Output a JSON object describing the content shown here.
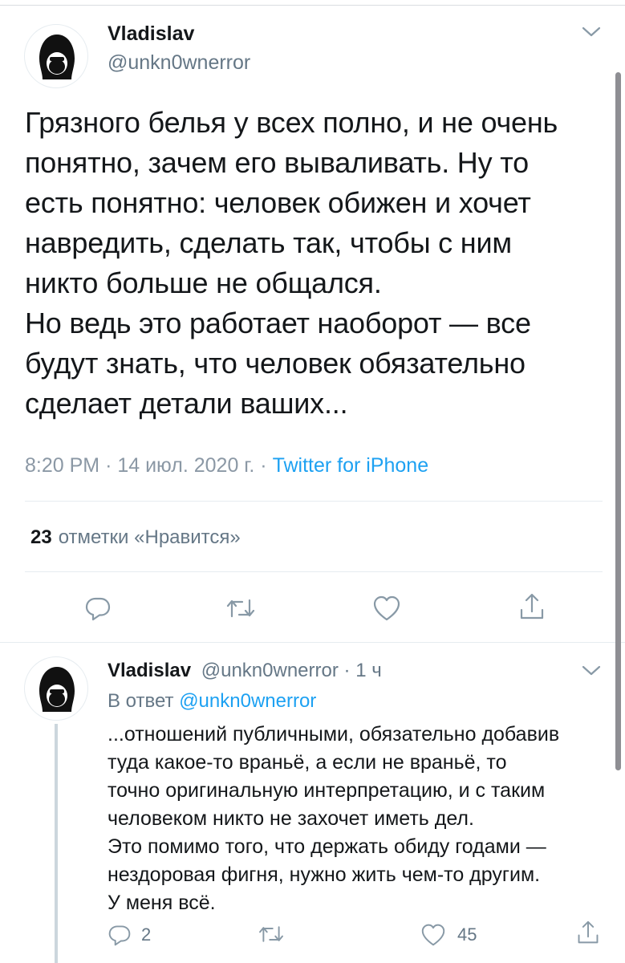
{
  "main_tweet": {
    "author_name": "Vladislav",
    "author_handle": "@unkn0wnerror",
    "text": "Грязного белья у всех полно, и не очень\nпонятно, зачем его вываливать. Ну то\nесть понятно: человек обижен и хочет\nнавредить, сделать так, чтобы с ним\nникто больше не общался.\nНо ведь это работает наоборот — все\nбудут знать, что человек обязательно\nсделает детали ваших...",
    "time": "8:20 PM",
    "date": "14 июл. 2020 г.",
    "source": "Twitter for iPhone",
    "separator": "·",
    "likes_count": "23",
    "likes_label": "отметки «Нравится»"
  },
  "reply_tweet": {
    "author_name": "Vladislav",
    "author_handle": "@unkn0wnerror",
    "time_ago": "1 ч",
    "separator": "·",
    "reply_prefix": "В ответ",
    "reply_to": "@unkn0wnerror",
    "text": "...отношений публичными, обязательно добавив\nтуда какое-то враньё, а если не враньё, то\nточно оригинальную интерпретацию, и с таким\nчеловеком никто не захочет иметь дел.\nЭто помимо того, что держать обиду годами —\nнездоровая фигня, нужно жить чем-то другим.\nУ меня всё.",
    "reply_count": "2",
    "like_count": "45"
  },
  "icons": [
    "reply-icon",
    "retweet-icon",
    "like-icon",
    "share-icon",
    "chevron-down-icon"
  ],
  "colors": {
    "accent": "#1da1f2",
    "text": "#14171a",
    "secondary": "#657786",
    "divider": "#e6ecf0"
  }
}
